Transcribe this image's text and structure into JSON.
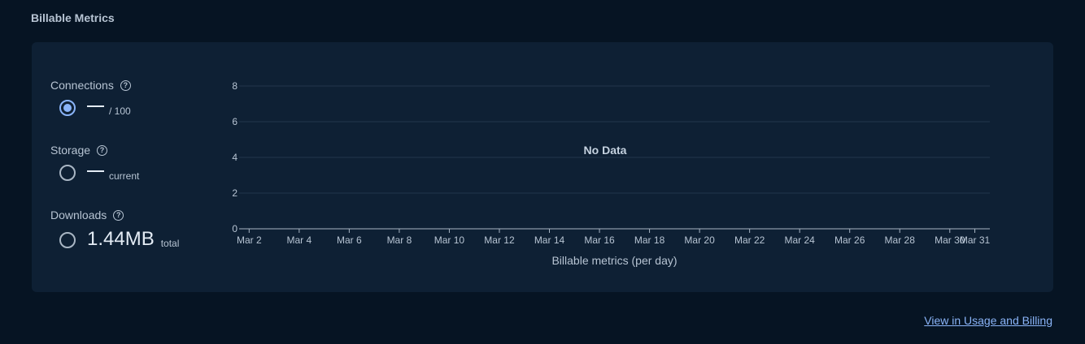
{
  "section": {
    "title": "Billable Metrics"
  },
  "metrics": [
    {
      "label": "Connections",
      "value": "",
      "suffix": "/ 100",
      "selected": true
    },
    {
      "label": "Storage",
      "value": "",
      "suffix": "current",
      "selected": false
    },
    {
      "label": "Downloads",
      "value": "1.44MB",
      "suffix": "total",
      "selected": false
    }
  ],
  "help_glyph": "?",
  "chart_data": {
    "type": "line",
    "title": "",
    "xlabel": "Billable metrics (per day)",
    "ylabel": "",
    "no_data_text": "No Data",
    "yticks": [
      0,
      2,
      4,
      6,
      8
    ],
    "ylim": [
      0,
      8
    ],
    "xticks": [
      "Mar 2",
      "Mar 4",
      "Mar 6",
      "Mar 8",
      "Mar 10",
      "Mar 12",
      "Mar 14",
      "Mar 16",
      "Mar 18",
      "Mar 20",
      "Mar 22",
      "Mar 24",
      "Mar 26",
      "Mar 28",
      "Mar 30",
      "Mar 31"
    ],
    "xtick_days": [
      2,
      4,
      6,
      8,
      10,
      12,
      14,
      16,
      18,
      20,
      22,
      24,
      26,
      28,
      30,
      31
    ],
    "xlim_days": [
      1.6,
      31.6
    ],
    "series": [],
    "grid": true
  },
  "colors": {
    "accent": "#8ab4f8",
    "background": "#061423",
    "card": "#0e2034"
  },
  "footer": {
    "link_label": "View in Usage and Billing"
  }
}
